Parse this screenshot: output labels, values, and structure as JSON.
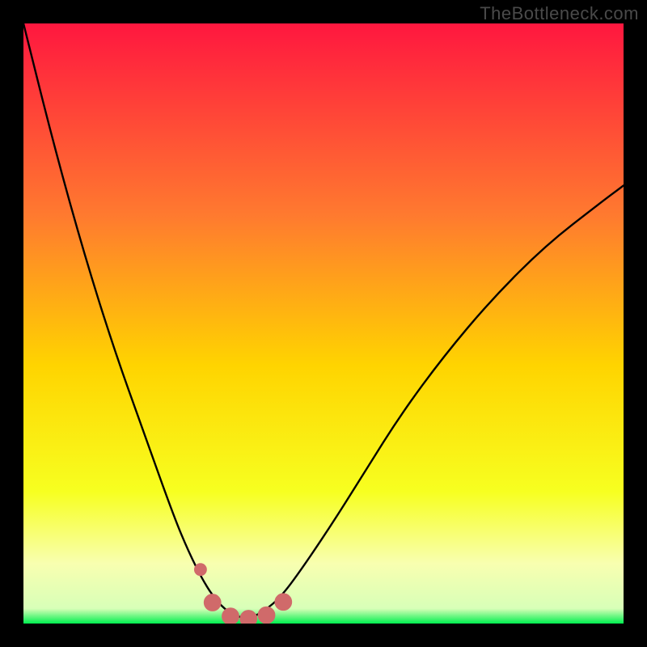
{
  "watermark": "TheBottleneck.com",
  "colors": {
    "frame": "#000000",
    "gradient_top": "#ff173f",
    "gradient_mid_upper": "#ff7a2f",
    "gradient_mid": "#ffd400",
    "gradient_mid_lower": "#f7ff20",
    "gradient_pale": "#f8ffb0",
    "gradient_green": "#00ef4f",
    "curve": "#000000",
    "marker_fill": "#d06a6a",
    "marker_stroke": "#d06a6a"
  },
  "chart_data": {
    "type": "line",
    "title": "",
    "xlabel": "",
    "ylabel": "",
    "xlim": [
      0,
      1
    ],
    "ylim": [
      0,
      1
    ],
    "series": [
      {
        "name": "bottleneck-curve",
        "x": [
          0.0,
          0.05,
          0.1,
          0.15,
          0.2,
          0.25,
          0.275,
          0.3,
          0.32,
          0.34,
          0.36,
          0.38,
          0.4,
          0.43,
          0.47,
          0.52,
          0.57,
          0.63,
          0.7,
          0.78,
          0.87,
          0.96,
          1.0
        ],
        "y": [
          1.0,
          0.8,
          0.62,
          0.46,
          0.32,
          0.18,
          0.12,
          0.07,
          0.04,
          0.02,
          0.01,
          0.01,
          0.02,
          0.045,
          0.1,
          0.175,
          0.255,
          0.35,
          0.445,
          0.54,
          0.63,
          0.7,
          0.73
        ]
      }
    ],
    "markers": [
      {
        "name": "marker-dot",
        "x": 0.295,
        "y": 0.09,
        "r": 0.01
      },
      {
        "name": "marker-left",
        "x": 0.315,
        "y": 0.035,
        "r": 0.014
      },
      {
        "name": "marker-mid-1",
        "x": 0.345,
        "y": 0.012,
        "r": 0.014
      },
      {
        "name": "marker-mid-2",
        "x": 0.375,
        "y": 0.008,
        "r": 0.014
      },
      {
        "name": "marker-mid-3",
        "x": 0.405,
        "y": 0.014,
        "r": 0.014
      },
      {
        "name": "marker-right",
        "x": 0.433,
        "y": 0.036,
        "r": 0.014
      }
    ]
  }
}
